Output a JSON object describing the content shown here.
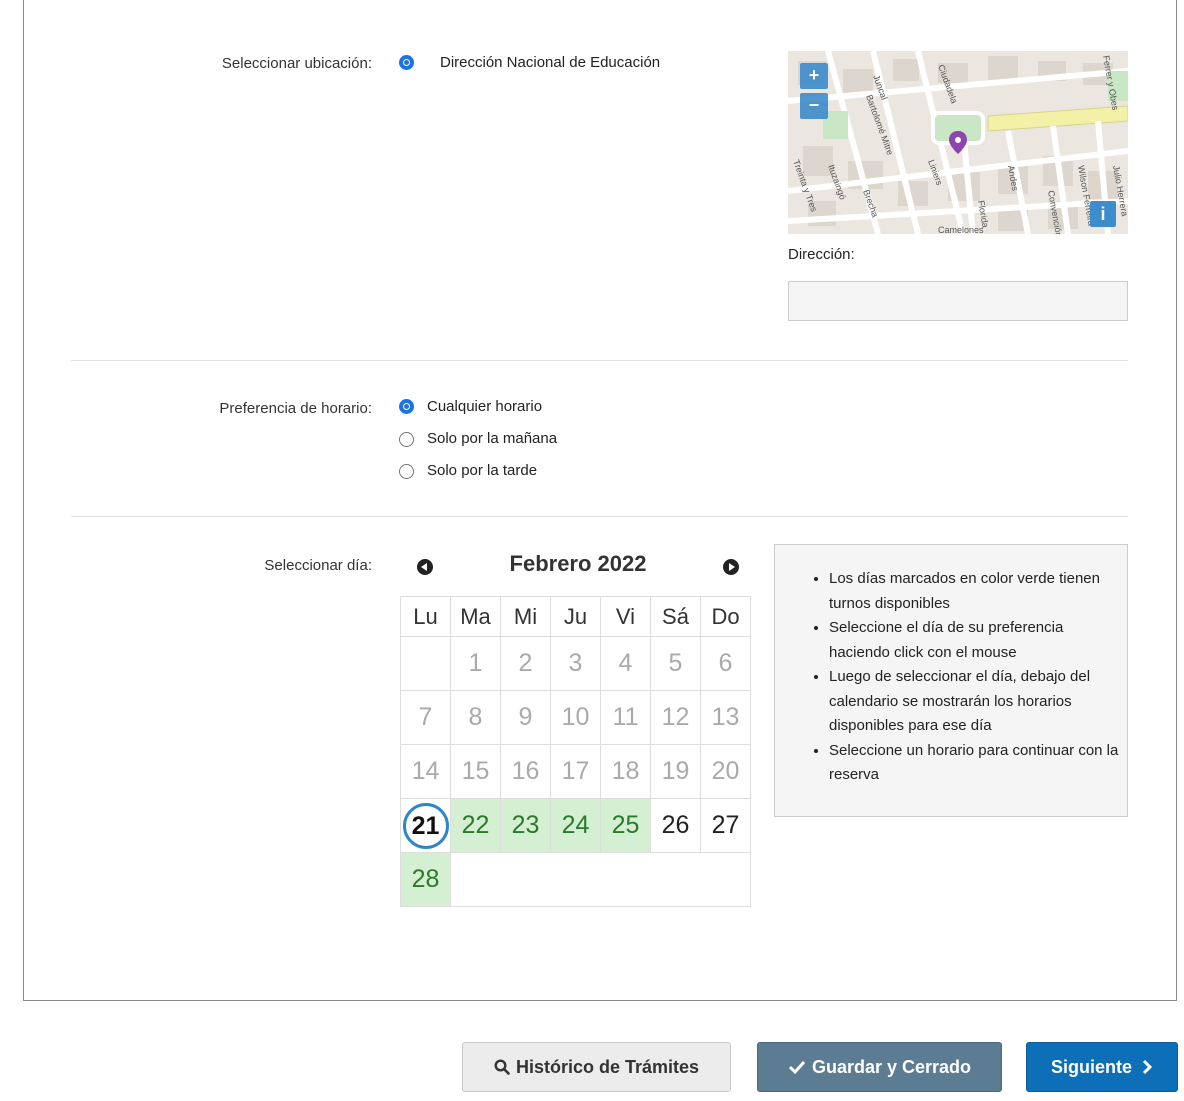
{
  "location": {
    "label": "Seleccionar ubicación:",
    "option": "Dirección Nacional de Educación",
    "address_label": "Dirección:",
    "address_value": "",
    "map": {
      "zoom_in": "+",
      "zoom_out": "−",
      "info": "i",
      "streets": [
        "Juncal",
        "Bartolomé Mitre",
        "Ituzaingó",
        "Brecha",
        "Liniers",
        "Andes",
        "Florida",
        "Convención",
        "Wilson Ferreira",
        "Julio Herrera",
        "Treinta y Tres",
        "Camelones",
        "Ciudadela",
        "Ferrer y Obes"
      ]
    }
  },
  "schedule": {
    "label": "Preferencia de horario:",
    "options": [
      "Cualquier horario",
      "Solo por la mañana",
      "Solo por la tarde"
    ],
    "selected": "Cualquier horario"
  },
  "day": {
    "label": "Seleccionar día:",
    "month_title": "Febrero 2022",
    "weekdays": [
      "Lu",
      "Ma",
      "Mi",
      "Ju",
      "Vi",
      "Sá",
      "Do"
    ],
    "weeks": [
      [
        "",
        "1",
        "2",
        "3",
        "4",
        "5",
        "6"
      ],
      [
        "7",
        "8",
        "9",
        "10",
        "11",
        "12",
        "13"
      ],
      [
        "14",
        "15",
        "16",
        "17",
        "18",
        "19",
        "20"
      ],
      [
        "21",
        "22",
        "23",
        "24",
        "25",
        "26",
        "27"
      ],
      [
        "28"
      ]
    ],
    "today": "21",
    "available": [
      "22",
      "23",
      "24",
      "25",
      "28"
    ],
    "enabled": [
      "21",
      "26",
      "27"
    ]
  },
  "info": {
    "items": [
      "Los días marcados en color verde tienen turnos disponibles",
      "Seleccione el día de su preferencia haciendo click con el mouse",
      "Luego de seleccionar el día, debajo del calendario se mostrarán los horarios disponibles para ese día",
      "Seleccione un horario para continuar con la reserva"
    ]
  },
  "buttons": {
    "history": "Histórico de Trámites",
    "save": "Guardar y Cerrado",
    "next": "Siguiente"
  },
  "colors": {
    "available_bg": "#d4efd2",
    "primary": "#0d6fb8",
    "save": "#5b7c93",
    "radio": "#1a73e8"
  }
}
